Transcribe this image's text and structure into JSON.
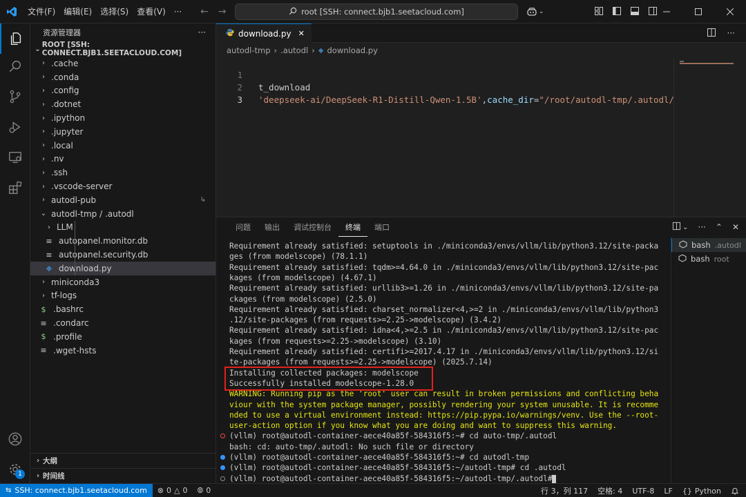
{
  "titlebar": {
    "menu": [
      "文件(F)",
      "编辑(E)",
      "选择(S)",
      "查看(V)",
      "···"
    ],
    "search_text": "root [SSH: connect.bjb1.seetacloud.com]"
  },
  "sidebar": {
    "title": "资源管理器",
    "more": "···",
    "root_label": "ROOT [SSH: CONNECT.BJB1.SEETACLOUD.COM]",
    "items": [
      {
        "label": ".cache",
        "chev": "›"
      },
      {
        "label": ".conda",
        "chev": "›"
      },
      {
        "label": ".config",
        "chev": "›"
      },
      {
        "label": ".dotnet",
        "chev": "›"
      },
      {
        "label": ".ipython",
        "chev": "›"
      },
      {
        "label": ".jupyter",
        "chev": "›"
      },
      {
        "label": ".local",
        "chev": "›"
      },
      {
        "label": ".nv",
        "chev": "›"
      },
      {
        "label": ".ssh",
        "chev": "›"
      },
      {
        "label": ".vscode-server",
        "chev": "›"
      },
      {
        "label": "autodl-pub",
        "chev": "›"
      },
      {
        "label": "autodl-tmp / .autodl",
        "chev": "⌄"
      },
      {
        "label": "LLM",
        "chev": "›"
      },
      {
        "label": "autopanel.monitor.db",
        "icon": "≡"
      },
      {
        "label": "autopanel.security.db",
        "icon": "≡"
      },
      {
        "label": "download.py",
        "icon": "◆"
      },
      {
        "label": "miniconda3",
        "chev": "›"
      },
      {
        "label": "tf-logs",
        "chev": "›"
      },
      {
        "label": ".bashrc",
        "icon": "$"
      },
      {
        "label": ".condarc",
        "icon": "≡"
      },
      {
        "label": ".profile",
        "icon": "$"
      },
      {
        "label": ".wget-hsts",
        "icon": "≡"
      }
    ],
    "outline_label": "大纲",
    "timeline_label": "时间线"
  },
  "editor": {
    "tab_label": "download.py",
    "tab_close": "✕",
    "breadcrumb": [
      "autodl-tmp",
      ".autodl",
      "download.py"
    ],
    "line_numbers": [
      "1",
      "2",
      "3"
    ],
    "line2_text": "t_download",
    "line3": {
      "str1": "'deepseek-ai/DeepSeek-R1-Distill-Qwen-1.5B'",
      "comma": ",",
      "kw": "cache_dir",
      "eq": "=",
      "str2": "\"/root/autodl-tmp/.autodl/LLM/\"",
      "close": ")"
    }
  },
  "panel": {
    "tabs": [
      "问题",
      "输出",
      "调试控制台",
      "终端",
      "端口"
    ],
    "active_tab": "终端",
    "terminal_lines": [
      "Requirement already satisfied: setuptools in ./miniconda3/envs/vllm/lib/python3.12/site-packa",
      "ges (from modelscope) (78.1.1)",
      "Requirement already satisfied: tqdm>=4.64.0 in ./miniconda3/envs/vllm/lib/python3.12/site-pac",
      "kages (from modelscope) (4.67.1)",
      "Requirement already satisfied: urllib3>=1.26 in ./miniconda3/envs/vllm/lib/python3.12/site-pa",
      "ckages (from modelscope) (2.5.0)",
      "Requirement already satisfied: charset_normalizer<4,>=2 in ./miniconda3/envs/vllm/lib/python3",
      ".12/site-packages (from requests>=2.25->modelscope) (3.4.2)",
      "Requirement already satisfied: idna<4,>=2.5 in ./miniconda3/envs/vllm/lib/python3.12/site-pac",
      "kages (from requests>=2.25->modelscope) (3.10)",
      "Requirement already satisfied: certifi>=2017.4.17 in ./miniconda3/envs/vllm/lib/python3.12/si",
      "te-packages (from requests>=2.25->modelscope) (2025.7.14)",
      "Installing collected packages: modelscope",
      "Successfully installed modelscope-1.28.0"
    ],
    "warning_lines": [
      "WARNING: Running pip as the 'root' user can result in broken permissions and conflicting beha",
      "viour with the system package manager, possibly rendering your system unusable. It is recomme",
      "nded to use a virtual environment instead: https://pip.pypa.io/warnings/venv. Use the --root-",
      "user-action option if you know what you are doing and want to suppress this warning."
    ],
    "command_lines": [
      {
        "text": "(vllm) root@autodl-container-aece40a85f-584316f5:~# cd auto-tmp/.autodl",
        "status": "error"
      },
      {
        "text": "bash: cd: auto-tmp/.autodl: No such file or directory",
        "status": "none"
      },
      {
        "text": "(vllm) root@autodl-container-aece40a85f-584316f5:~# cd autodl-tmp",
        "status": "ok"
      },
      {
        "text": "(vllm) root@autodl-container-aece40a85f-584316f5:~/autodl-tmp# cd .autodl",
        "status": "ok"
      },
      {
        "text": "(vllm) root@autodl-container-aece40a85f-584316f5:~/autodl-tmp/.autodl# ",
        "status": "pending"
      }
    ],
    "terminals": [
      {
        "name": "bash",
        "cwd": ".autodl"
      },
      {
        "name": "bash",
        "cwd": "root"
      }
    ]
  },
  "statusbar": {
    "remote": "SSH: connect.bjb1.seetacloud.com",
    "errors": "0",
    "warnings": "0",
    "ports": "0",
    "position": "行 3，列 117",
    "spaces": "空格: 4",
    "encoding": "UTF-8",
    "eol": "LF",
    "language": "Python",
    "language_braces": "{}",
    "account_badge": "1"
  },
  "colors": {
    "accent": "#0078d4",
    "highlight_box": "#e3221e",
    "warning_text": "#e5e510",
    "error_dot": "#f14c4c",
    "ok_dot": "#3794ff"
  }
}
